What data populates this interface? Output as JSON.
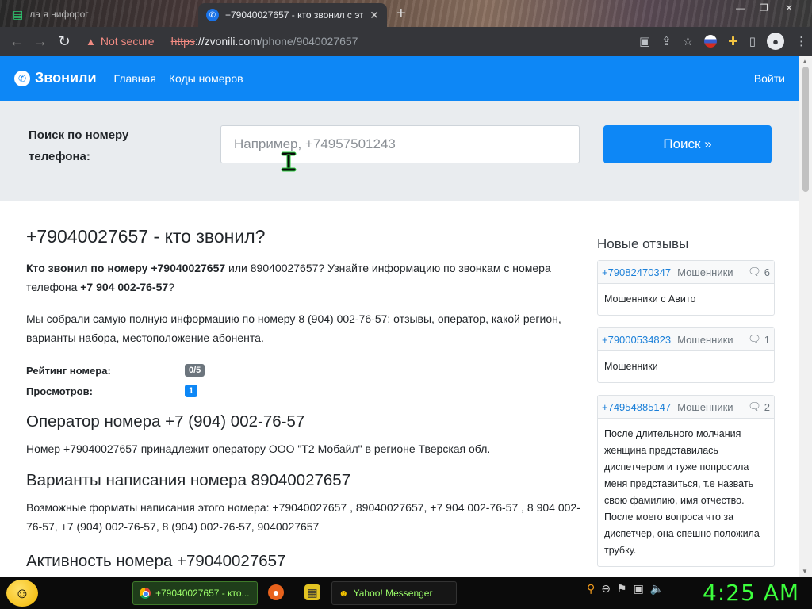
{
  "browser": {
    "inactive_tab_title": "ла я нифорог",
    "active_tab_title": "+79040027657 - кто звонил с эт",
    "security_label": "Not secure",
    "url_scheme": "https",
    "url_host": "://zvonili.com",
    "url_path": "/phone/9040027657"
  },
  "site": {
    "brand": "Звонили",
    "nav": [
      "Главная",
      "Коды номеров"
    ],
    "login": "Войти"
  },
  "search": {
    "label": "Поиск по номеру телефона:",
    "placeholder": "Например, +74957501243",
    "button": "Поиск »"
  },
  "main": {
    "title": "+79040027657 - кто звонил?",
    "intro_bold_1": "Кто звонил по номеру +79040027657",
    "intro_text_1": " или 89040027657? Узнайте информацию по звонкам с номера телефона ",
    "intro_bold_2": "+7 904 002-76-57",
    "intro_text_2": "?",
    "summary": "Мы собрали самую полную информацию по номеру 8 (904) 002-76-57: отзывы, оператор, какой регион, варианты набора, местоположение абонента.",
    "rating_label": "Рейтинг номера:",
    "rating_value": "0/5",
    "views_label": "Просмотров:",
    "views_value": "1",
    "operator_title": "Оператор номера +7 (904) 002-76-57",
    "operator_text": "Номер +79040027657 принадлежит оператору ООО \"Т2 Мобайл\" в регионе Тверская обл.",
    "variants_title": "Варианты написания номера 89040027657",
    "variants_text": "Возможные форматы написания этого номера: +79040027657 , 89040027657, +7 904 002-76-57 , 8 904 002-76-57, +7 (904) 002-76-57, 8 (904) 002-76-57, 9040027657",
    "activity_title": "Активность номера +79040027657"
  },
  "sidebar": {
    "title": "Новые отзывы",
    "reviews": [
      {
        "phone": "+79082470347",
        "tag": "Мошенники",
        "count": "6",
        "text": "Мошенники с Авито"
      },
      {
        "phone": "+79000534823",
        "tag": "Мошенники",
        "count": "1",
        "text": "Мошенники"
      },
      {
        "phone": "+74954885147",
        "tag": "Мошенники",
        "count": "2",
        "text": "После длительного молчания женщина представилась диспетчером и туже попросила меня представиться, т.е назвать свою фамилию, имя отчество. После моего вопроса что за диспетчер, она спешно положила трубку."
      }
    ]
  },
  "taskbar": {
    "chrome_task": "+79040027657 - кто...",
    "yahoo_task": "Yahoo! Messenger",
    "clock": "4:25 AM"
  },
  "icons": {
    "back": "back-arrow-icon",
    "forward": "forward-arrow-icon",
    "reload": "reload-icon",
    "warning": "warning-icon",
    "star": "bookmark-star-icon",
    "extensions": "puzzle-icon",
    "profile": "profile-icon",
    "menu": "kebab-menu-icon",
    "comments": "comments-icon"
  },
  "colors": {
    "brand_blue": "#0d87f6",
    "clock_green": "#3dff3d",
    "warning_red": "#f28b82"
  }
}
